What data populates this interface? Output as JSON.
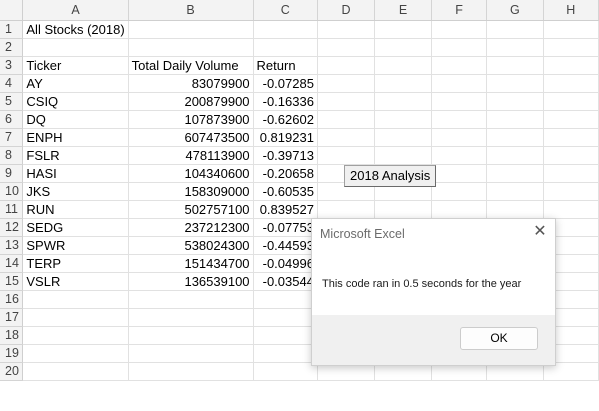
{
  "columns": [
    "A",
    "B",
    "C",
    "D",
    "E",
    "F",
    "G",
    "H"
  ],
  "rows": [
    "1",
    "2",
    "3",
    "4",
    "5",
    "6",
    "7",
    "8",
    "9",
    "10",
    "11",
    "12",
    "13",
    "14",
    "15",
    "16",
    "17",
    "18",
    "19",
    "20"
  ],
  "sheet": {
    "title": "All Stocks (2018)",
    "headers": [
      "Ticker",
      "Total Daily Volume",
      "Return"
    ],
    "data": [
      [
        "AY",
        "83079900",
        "-0.07285"
      ],
      [
        "CSIQ",
        "200879900",
        "-0.16336"
      ],
      [
        "DQ",
        "107873900",
        "-0.62602"
      ],
      [
        "ENPH",
        "607473500",
        "0.819231"
      ],
      [
        "FSLR",
        "478113900",
        "-0.39713"
      ],
      [
        "HASI",
        "104340600",
        "-0.20658"
      ],
      [
        "JKS",
        "158309000",
        "-0.60535"
      ],
      [
        "RUN",
        "502757100",
        "0.839527"
      ],
      [
        "SEDG",
        "237212300",
        "-0.07753"
      ],
      [
        "SPWR",
        "538024300",
        "-0.44593"
      ],
      [
        "TERP",
        "151434700",
        "-0.04996"
      ],
      [
        "VSLR",
        "136539100",
        "-0.03544"
      ]
    ]
  },
  "analysis_button": {
    "label": "2018 Analysis"
  },
  "dialog": {
    "title": "Microsoft Excel",
    "close_icon": "close-icon",
    "message": "This code ran in 0.5 seconds for the year",
    "ok_label": "OK"
  }
}
